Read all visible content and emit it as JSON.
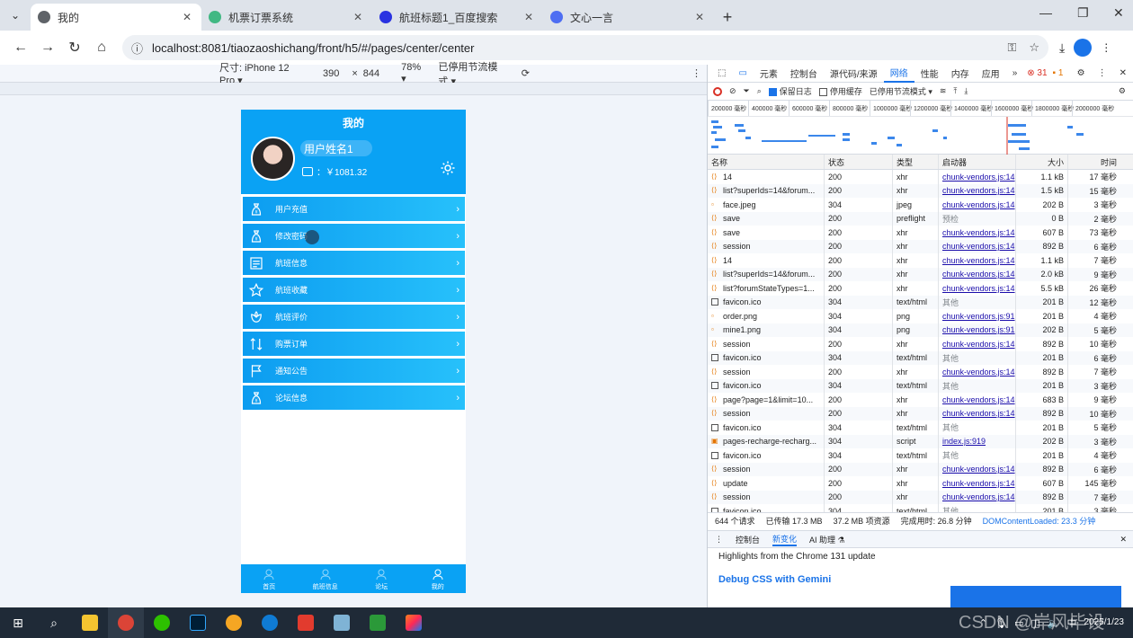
{
  "browser": {
    "tabs": [
      {
        "label": "我的",
        "active": true
      },
      {
        "label": "机票订票系统",
        "active": false
      },
      {
        "label": "航班标题1_百度搜索",
        "active": false
      },
      {
        "label": "文心一言",
        "active": false
      }
    ],
    "url": "localhost:8081/tiaozaoshichang/front/h5/#/pages/center/center"
  },
  "device_toolbar": {
    "device": "尺寸: iPhone 12 Pro ▾",
    "width": "390",
    "times": "×",
    "height": "844",
    "zoom": "78% ▾",
    "throttle": "已停用节流模式 ▾"
  },
  "app": {
    "header_title": "我的",
    "username": "用户姓名1",
    "balance": "：￥1081.32",
    "menu": [
      {
        "label": "用户充值",
        "icon": "money-bag-icon"
      },
      {
        "label": "修改密码",
        "icon": "money-bag-icon"
      },
      {
        "label": "航班信息",
        "icon": "list-icon"
      },
      {
        "label": "航班收藏",
        "icon": "star-icon"
      },
      {
        "label": "航班评价",
        "icon": "flower-icon"
      },
      {
        "label": "购票订单",
        "icon": "sort-icon"
      },
      {
        "label": "通知公告",
        "icon": "flag-icon"
      },
      {
        "label": "论坛信息",
        "icon": "money-bag-icon"
      }
    ],
    "tabbar": [
      {
        "label": "首页",
        "active": false
      },
      {
        "label": "航班信息",
        "active": false
      },
      {
        "label": "论坛",
        "active": false
      },
      {
        "label": "我的",
        "active": true
      }
    ]
  },
  "devtools": {
    "tabs": [
      "元素",
      "控制台",
      "源代码/来源",
      "网络",
      "性能",
      "内存",
      "应用"
    ],
    "active_tab": "网络",
    "errors": "31",
    "warnings": "1",
    "toolbar": {
      "preserve_log": "保留日志",
      "disable_cache": "停用缓存",
      "throttle": "已停用节流模式"
    },
    "timeline_ticks": [
      "200000 毫秒",
      "400000 毫秒",
      "600000 毫秒",
      "800000 毫秒",
      "1000000 毫秒",
      "1200000 毫秒",
      "1400000 毫秒",
      "1600000 毫秒",
      "1800000 毫秒",
      "2000000 毫秒"
    ],
    "columns": [
      "名称",
      "状态",
      "类型",
      "启动器",
      "大小",
      "时间"
    ],
    "rows": [
      {
        "name": "14",
        "status": "200",
        "type": "xhr",
        "initiator": "chunk-vendors.js:14",
        "size": "1.1 kB",
        "time": "17 毫秒",
        "icon": "xhr"
      },
      {
        "name": "list?superIds=14&forum...",
        "status": "200",
        "type": "xhr",
        "initiator": "chunk-vendors.js:14",
        "size": "1.5 kB",
        "time": "15 毫秒",
        "icon": "xhr"
      },
      {
        "name": "face.jpeg",
        "status": "304",
        "type": "jpeg",
        "initiator": "chunk-vendors.js:14",
        "size": "202 B",
        "time": "3 毫秒",
        "icon": "img"
      },
      {
        "name": "save",
        "status": "200",
        "type": "preflight",
        "initiator": "预检",
        "size": "0 B",
        "time": "2 毫秒",
        "icon": "xhr"
      },
      {
        "name": "save",
        "status": "200",
        "type": "xhr",
        "initiator": "chunk-vendors.js:14",
        "size": "607 B",
        "time": "73 毫秒",
        "icon": "xhr"
      },
      {
        "name": "session",
        "status": "200",
        "type": "xhr",
        "initiator": "chunk-vendors.js:14",
        "size": "892 B",
        "time": "6 毫秒",
        "icon": "xhr"
      },
      {
        "name": "14",
        "status": "200",
        "type": "xhr",
        "initiator": "chunk-vendors.js:14",
        "size": "1.1 kB",
        "time": "7 毫秒",
        "icon": "xhr"
      },
      {
        "name": "list?superIds=14&forum...",
        "status": "200",
        "type": "xhr",
        "initiator": "chunk-vendors.js:14",
        "size": "2.0 kB",
        "time": "9 毫秒",
        "icon": "xhr"
      },
      {
        "name": "list?forumStateTypes=1...",
        "status": "200",
        "type": "xhr",
        "initiator": "chunk-vendors.js:14",
        "size": "5.5 kB",
        "time": "26 毫秒",
        "icon": "xhr"
      },
      {
        "name": "favicon.ico",
        "status": "304",
        "type": "text/html",
        "initiator": "其他",
        "size": "201 B",
        "time": "12 毫秒",
        "icon": "doc"
      },
      {
        "name": "order.png",
        "status": "304",
        "type": "png",
        "initiator": "chunk-vendors.js:91",
        "size": "201 B",
        "time": "4 毫秒",
        "icon": "img"
      },
      {
        "name": "mine1.png",
        "status": "304",
        "type": "png",
        "initiator": "chunk-vendors.js:91",
        "size": "202 B",
        "time": "5 毫秒",
        "icon": "img"
      },
      {
        "name": "session",
        "status": "200",
        "type": "xhr",
        "initiator": "chunk-vendors.js:14",
        "size": "892 B",
        "time": "10 毫秒",
        "icon": "xhr"
      },
      {
        "name": "favicon.ico",
        "status": "304",
        "type": "text/html",
        "initiator": "其他",
        "size": "201 B",
        "time": "6 毫秒",
        "icon": "doc"
      },
      {
        "name": "session",
        "status": "200",
        "type": "xhr",
        "initiator": "chunk-vendors.js:14",
        "size": "892 B",
        "time": "7 毫秒",
        "icon": "xhr"
      },
      {
        "name": "favicon.ico",
        "status": "304",
        "type": "text/html",
        "initiator": "其他",
        "size": "201 B",
        "time": "3 毫秒",
        "icon": "doc"
      },
      {
        "name": "page?page=1&limit=10...",
        "status": "200",
        "type": "xhr",
        "initiator": "chunk-vendors.js:14",
        "size": "683 B",
        "time": "9 毫秒",
        "icon": "xhr"
      },
      {
        "name": "session",
        "status": "200",
        "type": "xhr",
        "initiator": "chunk-vendors.js:14",
        "size": "892 B",
        "time": "10 毫秒",
        "icon": "xhr"
      },
      {
        "name": "favicon.ico",
        "status": "304",
        "type": "text/html",
        "initiator": "其他",
        "size": "201 B",
        "time": "5 毫秒",
        "icon": "doc"
      },
      {
        "name": "pages-recharge-recharg...",
        "status": "304",
        "type": "script",
        "initiator": "index.js:919",
        "size": "202 B",
        "time": "3 毫秒",
        "icon": "script"
      },
      {
        "name": "favicon.ico",
        "status": "304",
        "type": "text/html",
        "initiator": "其他",
        "size": "201 B",
        "time": "4 毫秒",
        "icon": "doc"
      },
      {
        "name": "session",
        "status": "200",
        "type": "xhr",
        "initiator": "chunk-vendors.js:14",
        "size": "892 B",
        "time": "6 毫秒",
        "icon": "xhr"
      },
      {
        "name": "update",
        "status": "200",
        "type": "xhr",
        "initiator": "chunk-vendors.js:14",
        "size": "607 B",
        "time": "145 毫秒",
        "icon": "xhr"
      },
      {
        "name": "session",
        "status": "200",
        "type": "xhr",
        "initiator": "chunk-vendors.js:14",
        "size": "892 B",
        "time": "7 毫秒",
        "icon": "xhr"
      },
      {
        "name": "favicon.ico",
        "status": "304",
        "type": "text/html",
        "initiator": "其他",
        "size": "201 B",
        "time": "3 毫秒",
        "icon": "doc"
      }
    ],
    "summary": {
      "requests": "644 个请求",
      "transferred": "已传输 17.3 MB",
      "resources": "37.2 MB 项资源",
      "finish": "完成用时: 26.8 分钟",
      "dcl": "DOMContentLoaded: 23.3 分钟"
    },
    "drawer_tabs": [
      "控制台",
      "新变化",
      "AI 助理 ⚗"
    ],
    "drawer_active": "新变化",
    "whatsnew_intro": "Highlights from the Chrome 131 update",
    "whatsnew_title": "Debug CSS with Gemini"
  },
  "taskbar": {
    "time": "2025/1/23",
    "tray_lang": "中",
    "watermark": "CSDN @岸风毕设"
  }
}
